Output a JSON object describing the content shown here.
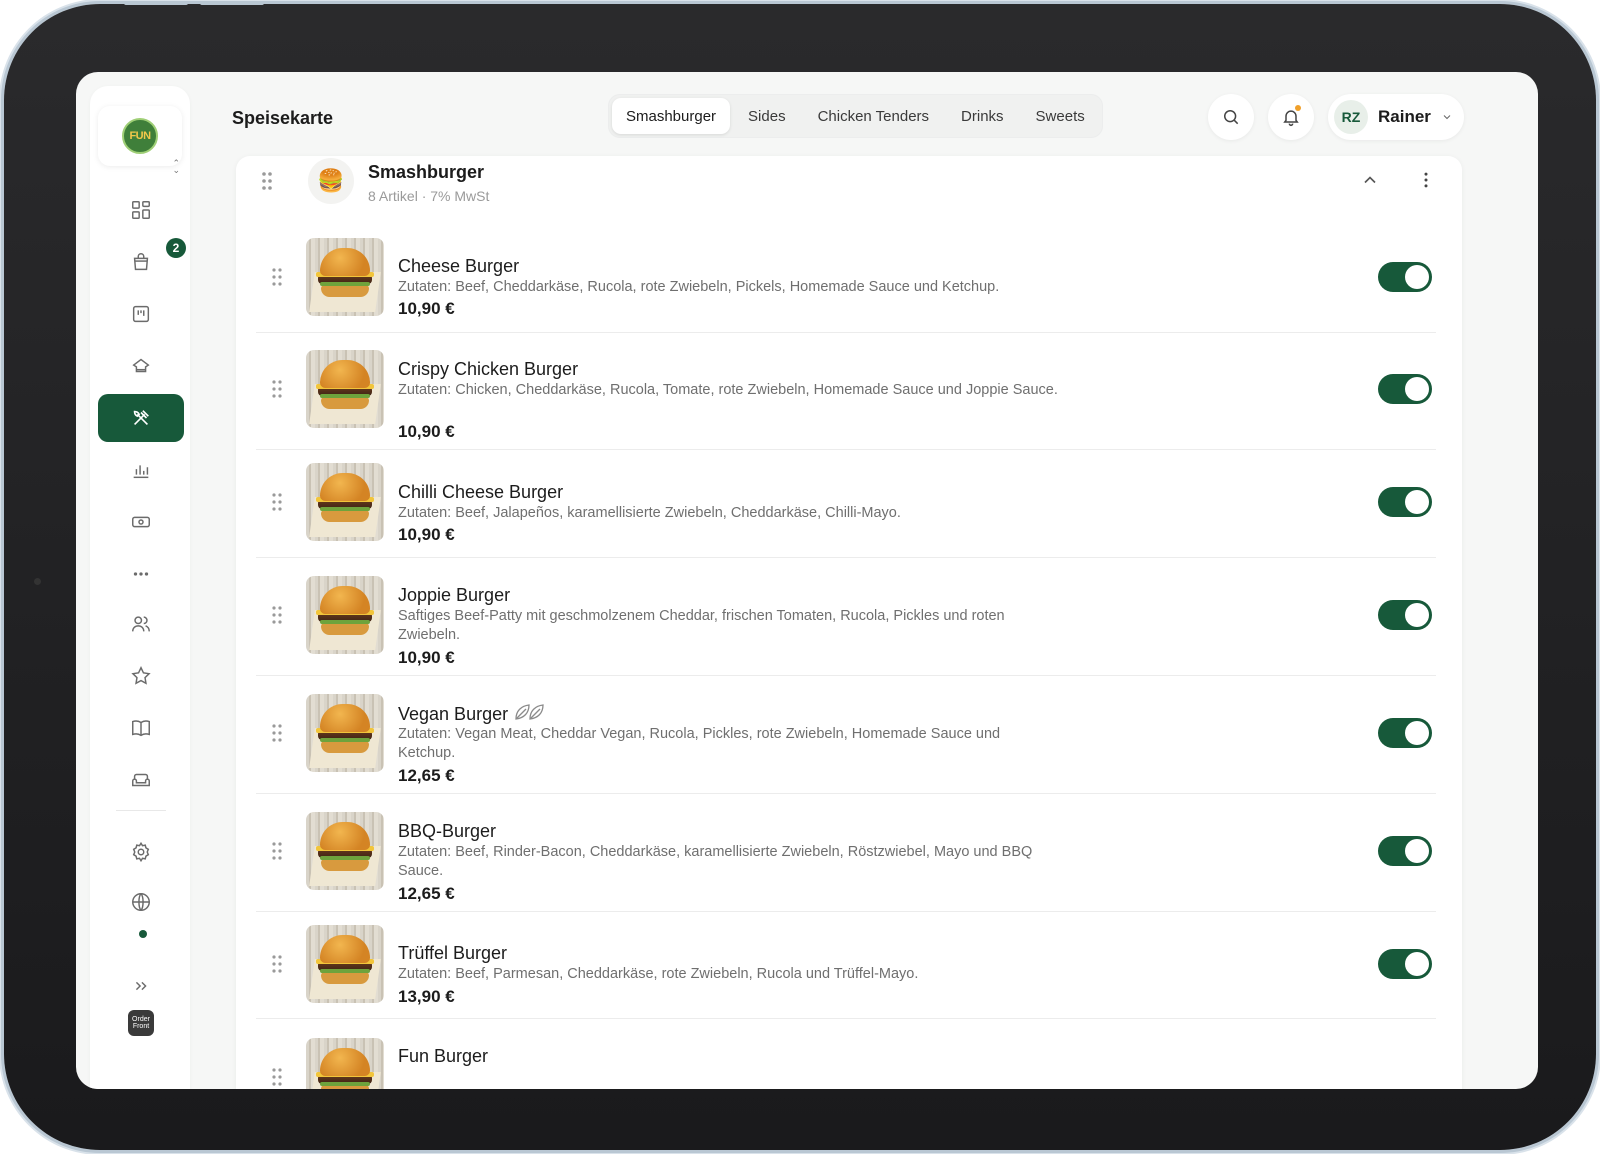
{
  "app": {
    "page_title": "Speisekarte"
  },
  "tabs": [
    {
      "label": "Smashburger",
      "active": true
    },
    {
      "label": "Sides",
      "active": false
    },
    {
      "label": "Chicken Tenders",
      "active": false
    },
    {
      "label": "Drinks",
      "active": false
    },
    {
      "label": "Sweets",
      "active": false
    }
  ],
  "user": {
    "initials": "RZ",
    "name": "Rainer"
  },
  "sidebar": {
    "logo_text": "FUN",
    "cart_badge": "2",
    "brand_small": "Order Front",
    "items": [
      {
        "icon": "dashboard-icon"
      },
      {
        "icon": "shopping-bag-icon"
      },
      {
        "icon": "kitchen-board-icon"
      },
      {
        "icon": "chef-hat-icon"
      },
      {
        "icon": "cutlery-icon",
        "active": true
      },
      {
        "icon": "bar-chart-icon"
      },
      {
        "icon": "cash-icon"
      },
      {
        "icon": "more-horizontal-icon"
      },
      {
        "icon": "users-icon"
      },
      {
        "icon": "star-icon"
      },
      {
        "icon": "book-icon"
      },
      {
        "icon": "sofa-icon"
      },
      {
        "icon": "settings-gear-icon"
      },
      {
        "icon": "globe-icon"
      },
      {
        "icon": "expand-icon"
      }
    ]
  },
  "category": {
    "emoji": "🍔",
    "title": "Smashburger",
    "subtitle": "8 Artikel · 7% MwSt"
  },
  "items": [
    {
      "name": "Cheese Burger",
      "desc": "Zutaten: Beef, Cheddarkäse, Rucola, rote Zwiebeln, Pickels, Homemade Sauce und Ketchup.",
      "price": "10,90 €",
      "enabled": true
    },
    {
      "name": "Crispy Chicken Burger",
      "desc": "Zutaten: Chicken, Cheddarkäse, Rucola, Tomate, rote Zwiebeln, Homemade Sauce und Joppie Sauce.",
      "price": "10,90 €",
      "enabled": true
    },
    {
      "name": "Chilli Cheese Burger",
      "desc": "Zutaten: Beef, Jalapeños, karamellisierte Zwiebeln, Cheddarkäse, Chilli-Mayo.",
      "price": "10,90 €",
      "enabled": true
    },
    {
      "name": "Joppie Burger",
      "desc": "Saftiges Beef-Patty mit geschmolzenem Cheddar, frischen Tomaten, Rucola, Pickles und roten Zwiebeln.",
      "price": "10,90 €",
      "enabled": true
    },
    {
      "name": "Vegan Burger",
      "desc": "Zutaten: Vegan Meat, Cheddar Vegan, Rucola, Pickles, rote Zwiebeln, Homemade Sauce und Ketchup.",
      "price": "12,65 €",
      "enabled": true,
      "vegan": true
    },
    {
      "name": "BBQ-Burger",
      "desc": "Zutaten: Beef, Rinder-Bacon, Cheddarkäse, karamellisierte Zwiebeln, Röstzwiebel, Mayo und BBQ Sauce.",
      "price": "12,65 €",
      "enabled": true
    },
    {
      "name": "Trüffel Burger",
      "desc": "Zutaten: Beef, Parmesan, Cheddarkäse, rote Zwiebeln, Rucola und Trüffel-Mayo.",
      "price": "13,90 €",
      "enabled": true
    },
    {
      "name": "Fun Burger",
      "desc": "",
      "price": "",
      "enabled": true
    }
  ],
  "colors": {
    "accent": "#17593a",
    "notification": "#f0a02a"
  }
}
